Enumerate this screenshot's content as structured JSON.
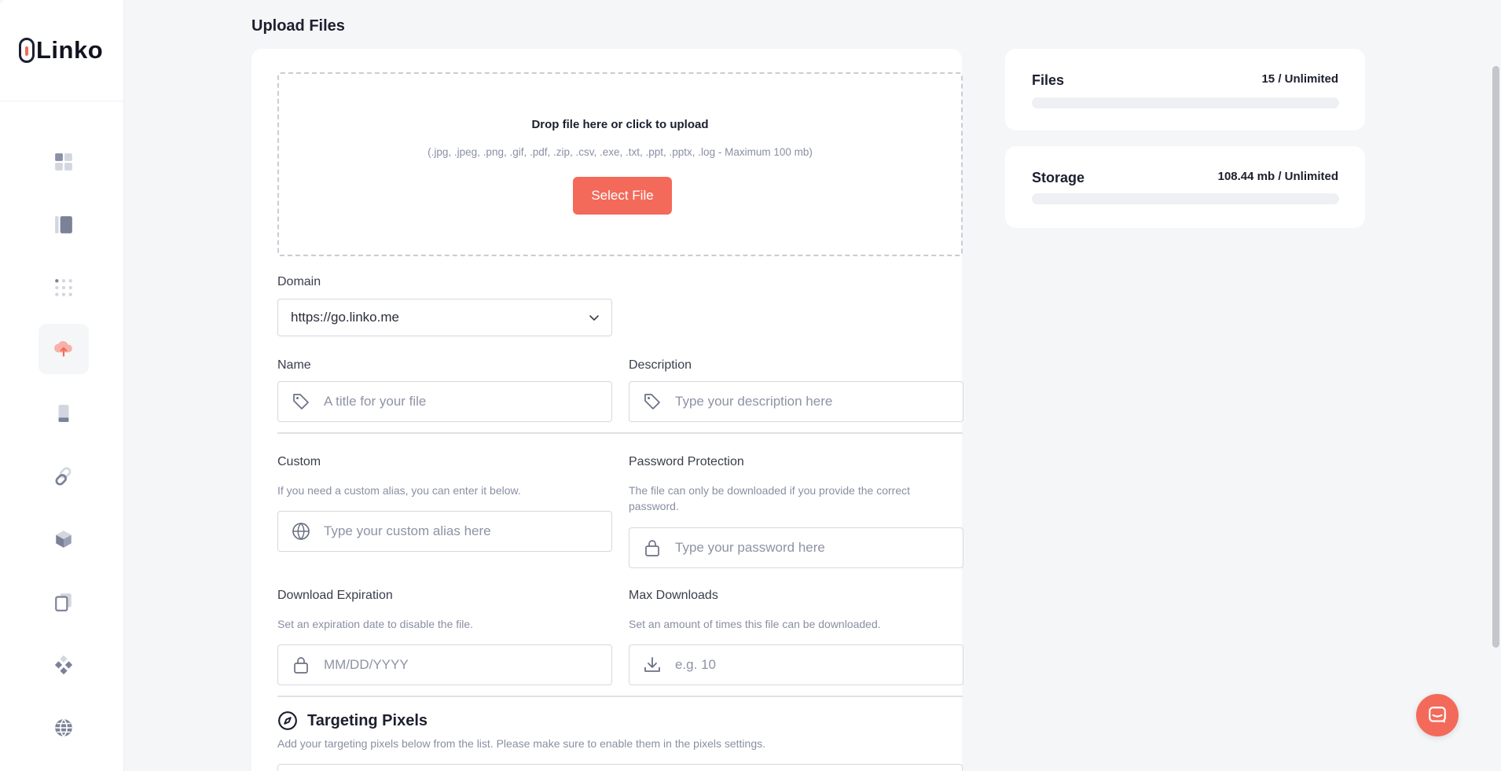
{
  "brand": {
    "name": "Linko",
    "accent": "#f36a5b"
  },
  "sidebar": {
    "items": [
      {
        "icon": "dashboard-icon",
        "active": false
      },
      {
        "icon": "links-list-icon",
        "active": false
      },
      {
        "icon": "dots-grid-icon",
        "active": false
      },
      {
        "icon": "cloud-upload-icon",
        "active": true
      },
      {
        "icon": "mobile-icon",
        "active": false
      },
      {
        "icon": "link-chain-icon",
        "active": false
      },
      {
        "icon": "cube-icon",
        "active": false
      },
      {
        "icon": "copy-pages-icon",
        "active": false
      },
      {
        "icon": "diamond-tiles-icon",
        "active": false
      },
      {
        "icon": "globe-icon",
        "active": false
      }
    ]
  },
  "page": {
    "title": "Upload Files"
  },
  "upload": {
    "title": "Drop file here or click to upload",
    "formats": "(.jpg, .jpeg, .png, .gif, .pdf, .zip, .csv, .exe, .txt, .ppt, .pptx, .log - Maximum 100 mb)",
    "button": "Select File"
  },
  "form": {
    "domain": {
      "label": "Domain",
      "value": "https://go.linko.me"
    },
    "name": {
      "label": "Name",
      "placeholder": "A title for your file"
    },
    "description": {
      "label": "Description",
      "placeholder": "Type your description here"
    },
    "custom": {
      "label": "Custom",
      "help": "If you need a custom alias, you can enter it below.",
      "placeholder": "Type your custom alias here"
    },
    "password": {
      "label": "Password Protection",
      "help": "The file can only be downloaded if you provide the correct password.",
      "placeholder": "Type your password here"
    },
    "expiration": {
      "label": "Download Expiration",
      "help": "Set an expiration date to disable the file.",
      "placeholder": "MM/DD/YYYY"
    },
    "max_downloads": {
      "label": "Max Downloads",
      "help": "Set an amount of times this file can be downloaded.",
      "placeholder": "e.g. 10"
    }
  },
  "targeting": {
    "title": "Targeting Pixels",
    "help": "Add your targeting pixels below from the list. Please make sure to enable them in the pixels settings."
  },
  "stats": {
    "files": {
      "label": "Files",
      "value": "15 / Unlimited",
      "fill": 0
    },
    "storage": {
      "label": "Storage",
      "value": "108.44 mb / Unlimited",
      "fill": 0
    }
  }
}
